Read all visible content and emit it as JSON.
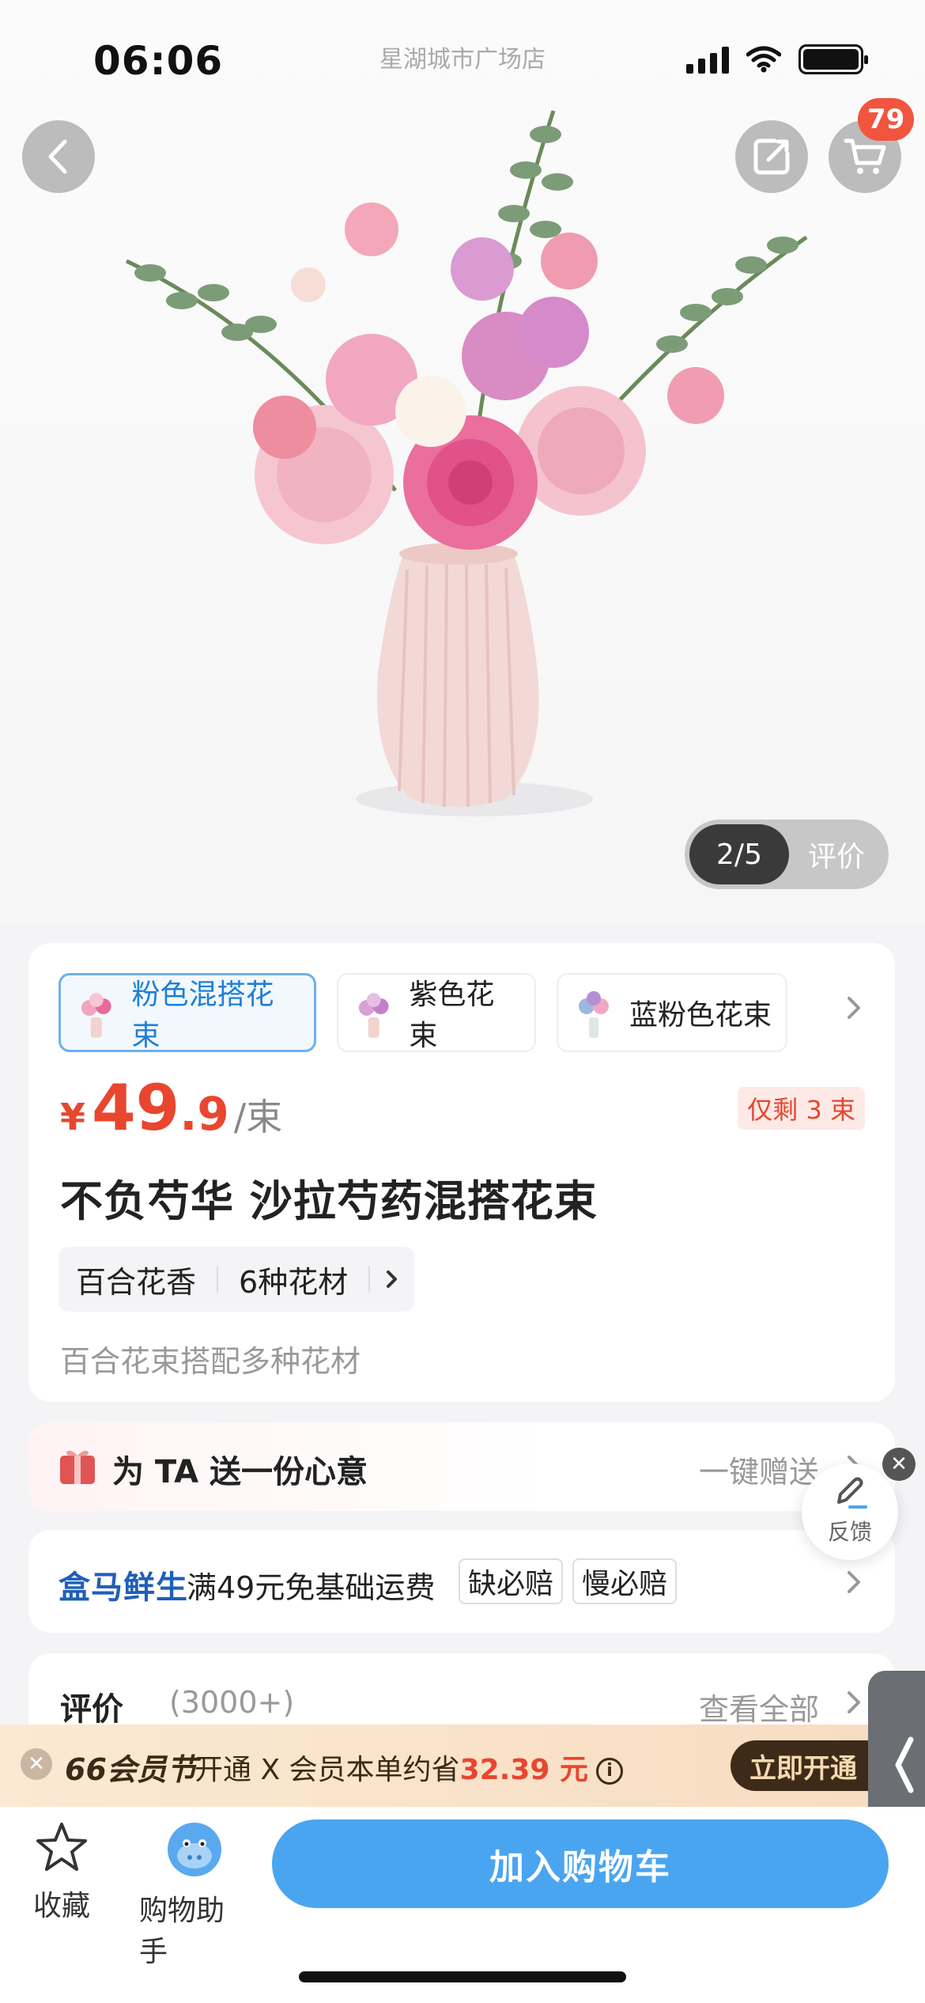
{
  "status_bar": {
    "time": "06:06",
    "store": "星湖城市广场店"
  },
  "header": {
    "cart_count": "79"
  },
  "gallery": {
    "page": "2/5",
    "review_tab": "评价"
  },
  "variants": [
    {
      "label": "粉色混搭花束",
      "selected": true
    },
    {
      "label": "紫色花束",
      "selected": false
    },
    {
      "label": "蓝粉色花束",
      "selected": false
    }
  ],
  "price": {
    "currency": "¥",
    "integer": "49",
    "decimal": ".9",
    "unit": "/束"
  },
  "stock": "仅剩 3 束",
  "product": {
    "title": "不负芍华 沙拉芍药混搭花束",
    "tags": [
      "百合花香",
      "6种花材"
    ],
    "subtitle": "百合花束搭配多种花材"
  },
  "gift": {
    "text": "为 TA 送一份心意",
    "action": "一键赠送"
  },
  "feedback": {
    "label": "反馈"
  },
  "shipping": {
    "brand": "盒马鲜生",
    "text": "满49元免基础运费",
    "tags": [
      "缺必赔",
      "慢必赔"
    ]
  },
  "reviews": {
    "title": "评价",
    "count": "(3000+)",
    "view_all": "查看全部"
  },
  "member_banner": {
    "logo": "66会员节",
    "text_prefix": "开通 X 会员本单约省",
    "amount": "32.39 元",
    "button": "立即开通"
  },
  "bottom_bar": {
    "favorite": "收藏",
    "assistant": "购物助手",
    "add_to_cart": "加入购物车"
  },
  "colors": {
    "accent": "#e8462f",
    "primary_blue": "#4aa5f0",
    "brand_blue": "#1f5fb8",
    "background": "#f4f4f6"
  }
}
